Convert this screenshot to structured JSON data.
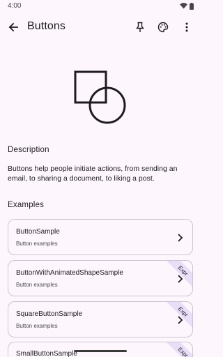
{
  "status_bar": {
    "time": "4:00"
  },
  "top_bar": {
    "title": "Buttons"
  },
  "description": {
    "heading": "Description",
    "body": "Buttons help people initiate actions, from sending an email, to sharing a document, to liking a post."
  },
  "examples": {
    "heading": "Examples",
    "items": [
      {
        "title": "ButtonSample",
        "subtitle": "Button examples",
        "badge": ""
      },
      {
        "title": "ButtonWithAnimatedShapeSample",
        "subtitle": "Button examples",
        "badge": "Expr"
      },
      {
        "title": "SquareButtonSample",
        "subtitle": "Button examples",
        "badge": "Expr"
      },
      {
        "title": "SmallButtonSample",
        "subtitle": "",
        "badge": "Expr"
      }
    ]
  },
  "colors": {
    "background": "#fdf7fd",
    "ribbon": "#e8def8",
    "border": "#cac4d0"
  }
}
